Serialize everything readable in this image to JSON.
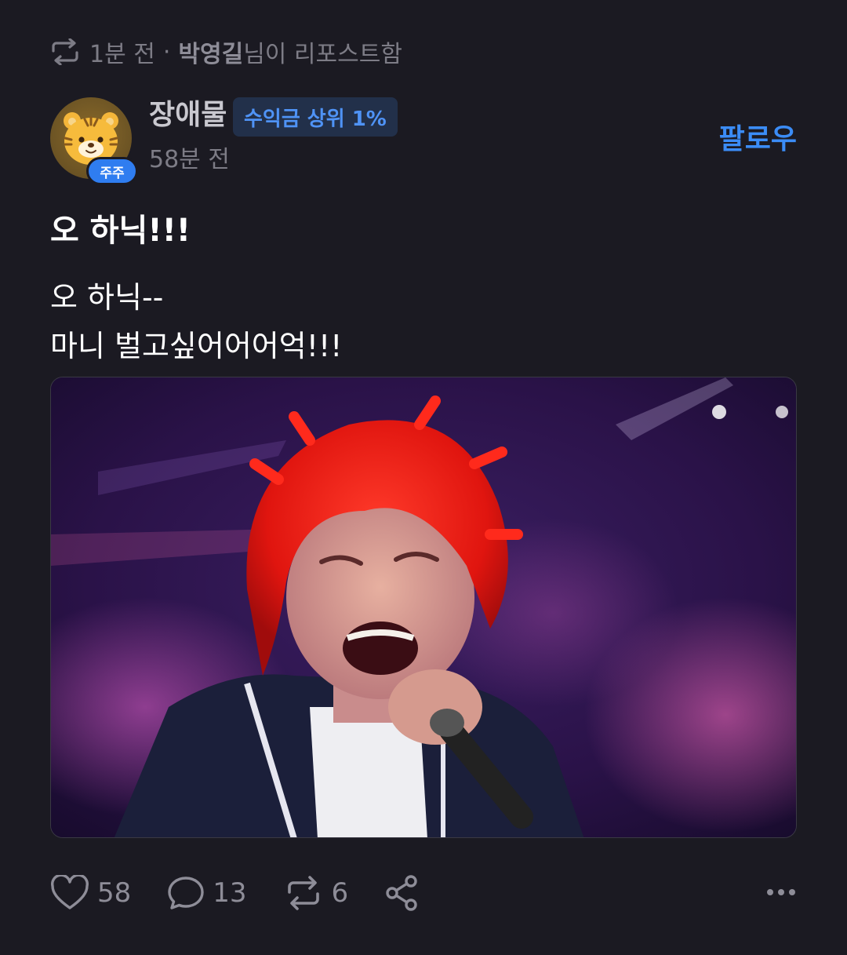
{
  "repost": {
    "icon": "repost-icon",
    "time": "1분 전",
    "separator": "·",
    "user": "박영길",
    "suffix": "님이 리포스트함"
  },
  "author": {
    "avatar_badge": "주주",
    "name": "장애물",
    "rank_badge": "수익금 상위 1%",
    "time": "58분 전",
    "follow_label": "팔로우"
  },
  "post": {
    "title": "오 하닉!!!",
    "body_lines": [
      "오 하닉--",
      "마니 벌고싶어어어억!!!"
    ]
  },
  "actions": {
    "likes": "58",
    "comments": "13",
    "reposts": "6"
  },
  "colors": {
    "background": "#1b1a22",
    "accent": "#3b8cf6",
    "muted": "#7d7c86",
    "badge_bg": "#22304a"
  }
}
